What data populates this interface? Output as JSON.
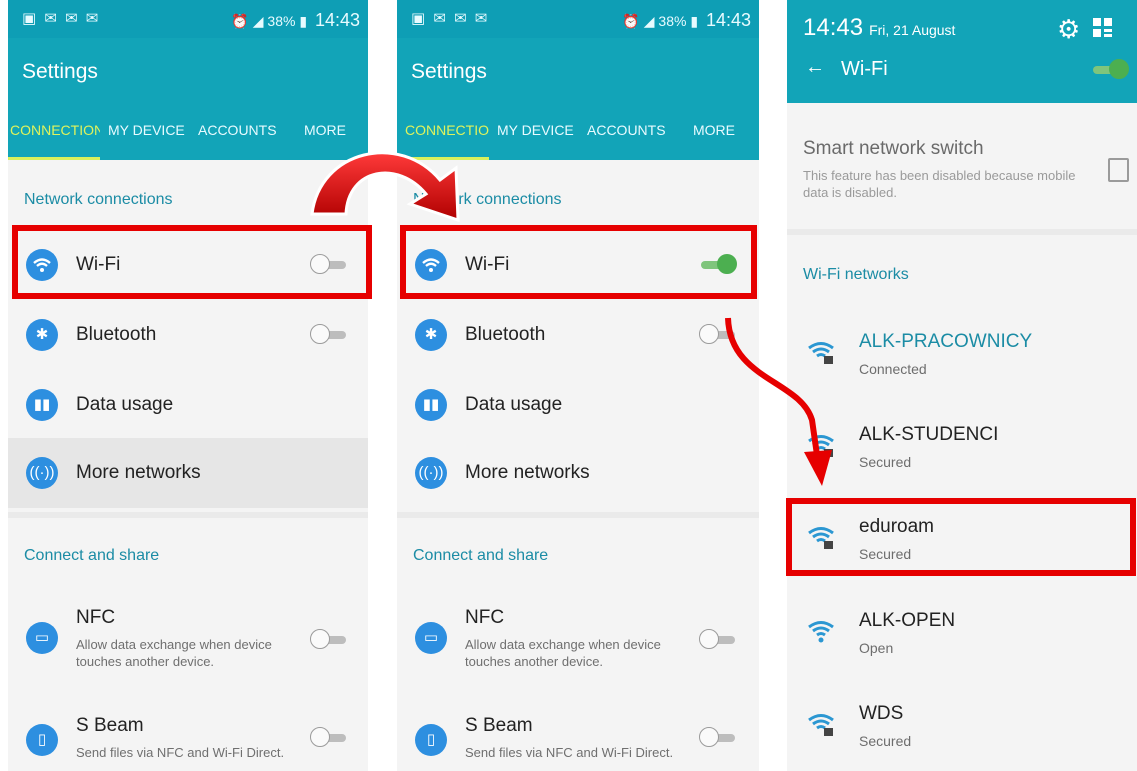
{
  "status": {
    "time": "14:43",
    "battery": "38%"
  },
  "settings": {
    "title": "Settings",
    "tabs": [
      "CONNECTIONS",
      "MY DEVICE",
      "ACCOUNTS",
      "MORE"
    ],
    "section_network": "Network connections",
    "section_share": "Connect and share",
    "items": {
      "wifi": "Wi-Fi",
      "bluetooth": "Bluetooth",
      "data_usage": "Data usage",
      "more_networks": "More networks",
      "nfc": "NFC",
      "nfc_desc": "Allow data exchange when device touches another device.",
      "sbeam": "S Beam",
      "sbeam_desc": "Send files via NFC and Wi-Fi Direct."
    }
  },
  "wifi_screen": {
    "time": "14:43",
    "date": "Fri, 21 August",
    "title": "Wi-Fi",
    "smart_switch_title": "Smart network switch",
    "smart_switch_desc": "This feature has been disabled because mobile data is disabled.",
    "networks_header": "Wi-Fi networks",
    "networks": [
      {
        "name": "ALK-PRACOWNICY",
        "status": "Connected"
      },
      {
        "name": "ALK-STUDENCI",
        "status": "Secured"
      },
      {
        "name": "eduroam",
        "status": "Secured"
      },
      {
        "name": "ALK-OPEN",
        "status": "Open"
      },
      {
        "name": "WDS",
        "status": "Secured"
      }
    ]
  },
  "colors": {
    "header": "#12a4b8",
    "accent": "#1b8ca5",
    "highlight_box": "#e60000",
    "toggle_on": "#4caf50"
  }
}
